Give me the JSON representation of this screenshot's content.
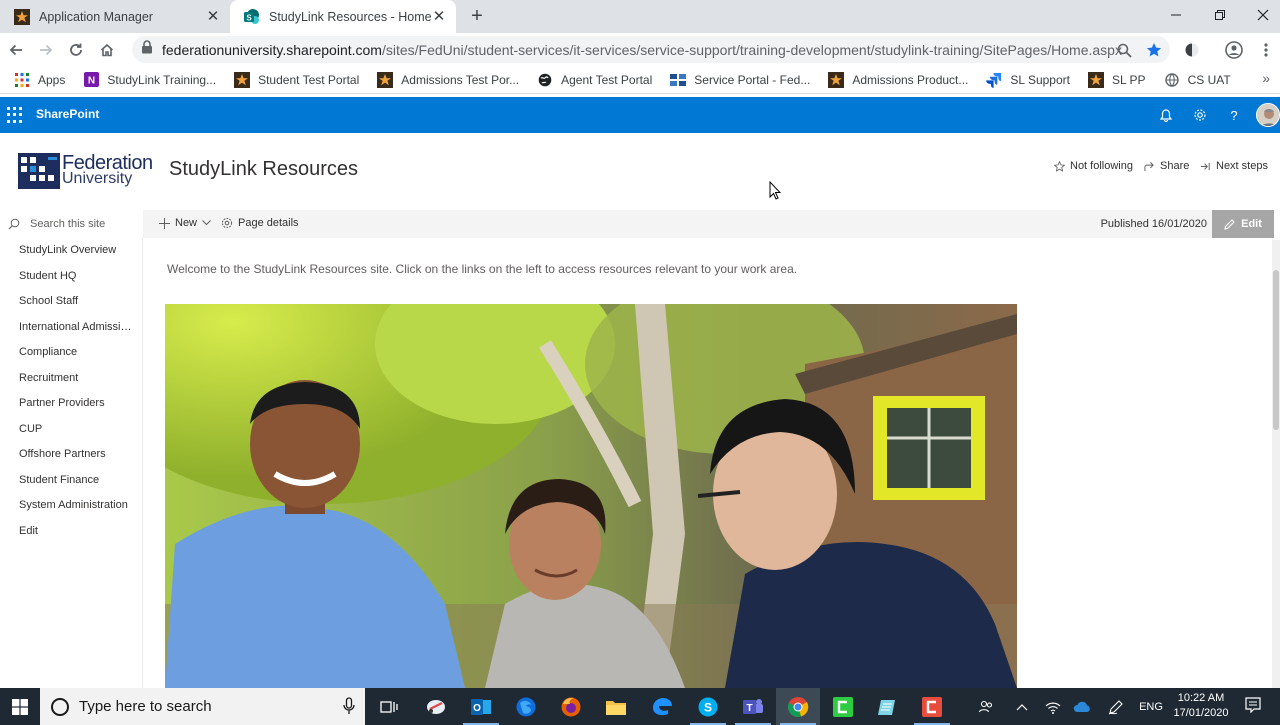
{
  "browser": {
    "tabs": [
      {
        "title": "Application Manager",
        "active": false
      },
      {
        "title": "StudyLink Resources - Home",
        "active": true
      }
    ],
    "url_host": "federationuniversity.sharepoint.com",
    "url_path": "/sites/FedUni/student-services/it-services/service-support/training-development/studylink-training/SitePages/Home.aspx",
    "bookmarks": [
      {
        "label": "Apps",
        "icon": "apps-grid-icon"
      },
      {
        "label": "StudyLink Training...",
        "icon": "onenote-icon"
      },
      {
        "label": "Student Test Portal",
        "icon": "feduni-star-icon"
      },
      {
        "label": "Admissions Test Por...",
        "icon": "feduni-star-icon"
      },
      {
        "label": "Agent Test Portal",
        "icon": "globe-icon"
      },
      {
        "label": "Service Portal - Fed...",
        "icon": "service-portal-icon"
      },
      {
        "label": "Admissions Product...",
        "icon": "feduni-star-icon"
      },
      {
        "label": "SL Support",
        "icon": "jira-icon"
      },
      {
        "label": "SL PP",
        "icon": "feduni-star-icon"
      },
      {
        "label": "CS UAT",
        "icon": "globe-icon"
      }
    ]
  },
  "suite": {
    "title": "SharePoint"
  },
  "site": {
    "logo_line1": "Federation",
    "logo_line2": "University",
    "title": "StudyLink Resources",
    "not_following": "Not following",
    "share": "Share",
    "next_steps": "Next steps"
  },
  "command_bar": {
    "new_label": "New",
    "page_details": "Page details",
    "published": "Published 16/01/2020",
    "edit": "Edit"
  },
  "left_nav": {
    "search_placeholder": "Search this site",
    "items": [
      "StudyLink Overview",
      "Student HQ",
      "School Staff",
      "International Admissio...",
      "Compliance",
      "Recruitment",
      "Partner Providers",
      "CUP",
      "Offshore Partners",
      "Student Finance",
      "System Administration",
      "Edit"
    ]
  },
  "content": {
    "welcome": "Welcome to the StudyLink Resources site. Click on the links on the left to access resources relevant to your work area."
  },
  "taskbar": {
    "search_placeholder": "Type here to search",
    "language": "ENG",
    "time": "10:22 AM",
    "date": "17/01/2020"
  },
  "colors": {
    "suite_bar": "#0078d4",
    "edit_button": "#a6a6a6",
    "taskbar": "#1f2933"
  }
}
